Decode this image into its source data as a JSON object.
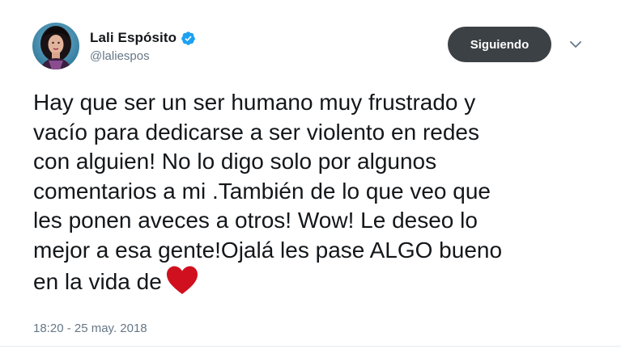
{
  "user": {
    "display_name": "Lali Espósito",
    "handle": "@laliespos",
    "verified": true
  },
  "follow_button": {
    "label": "Siguiendo"
  },
  "tweet": {
    "lines": [
      "Hay que ser un ser humano muy frustrado y",
      "vacío para dedicarse a ser violento en redes",
      "con alguien! No lo digo solo por algunos",
      "comentarios a mi .También de lo que veo que",
      "les ponen aveces a otros! Wow! Le deseo lo",
      "mejor a esa gente!Ojalá les pase ALGO bueno",
      "en la vida de"
    ],
    "emoji": "heart-icon",
    "timestamp": "18:20 - 25 may. 2018"
  },
  "colors": {
    "text": "#14171a",
    "secondary": "#657786",
    "verified_blue": "#1da1f2",
    "button_bg": "#3b4144",
    "heart": "#d0101f"
  }
}
